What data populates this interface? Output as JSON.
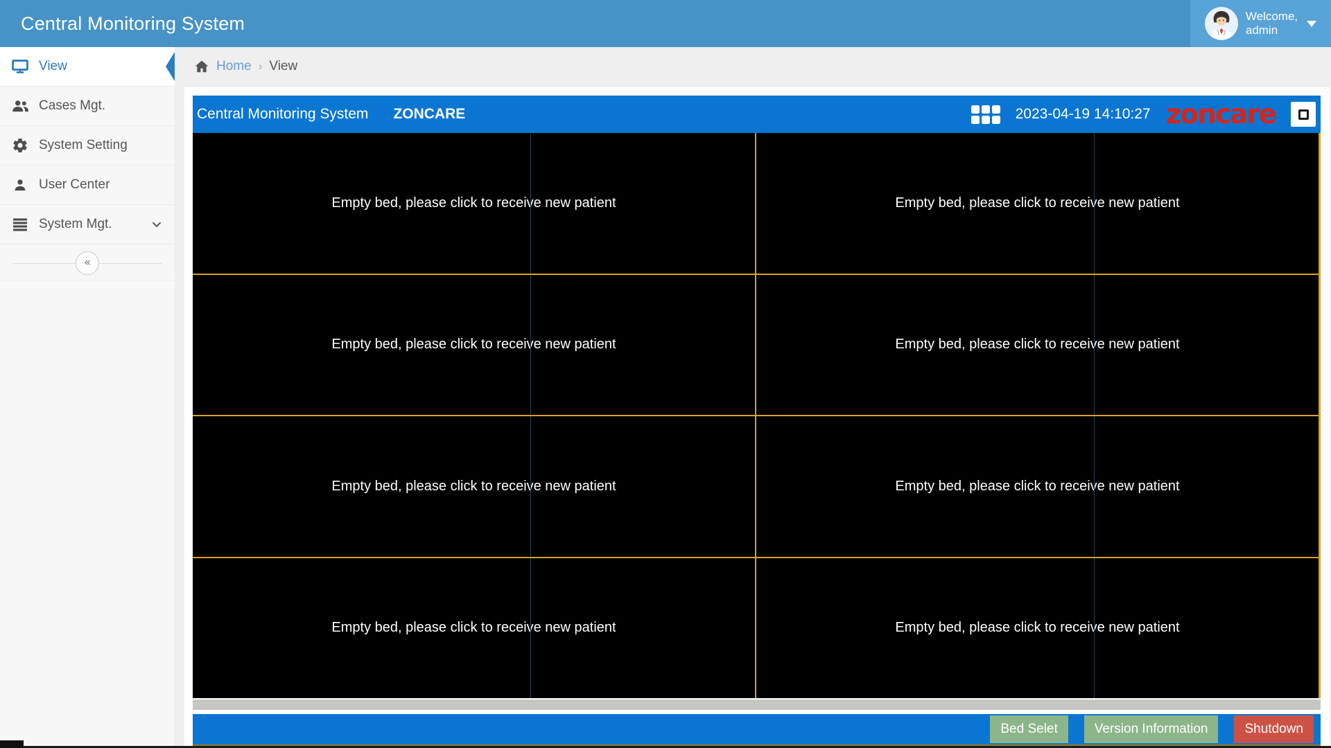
{
  "window_title": "Central Monitoring System",
  "header": {
    "welcome_line1": "Welcome,",
    "welcome_line2": "admin"
  },
  "sidebar": {
    "items": [
      {
        "label": "View",
        "icon": "monitor",
        "active": true
      },
      {
        "label": "Cases Mgt.",
        "icon": "users",
        "active": false
      },
      {
        "label": "System Setting",
        "icon": "gear",
        "active": false
      },
      {
        "label": "User Center",
        "icon": "user",
        "active": false
      },
      {
        "label": "System Mgt.",
        "icon": "menu",
        "active": false,
        "expandable": true
      }
    ],
    "collapse_glyph": "«"
  },
  "breadcrumb": {
    "home": "Home",
    "separator": "›",
    "current": "View"
  },
  "monitor": {
    "titlebar": {
      "title": "Central Monitoring System",
      "brand": "ZONCARE",
      "timestamp": "2023-04-19 14:10:27",
      "logo_text": "zoncare"
    },
    "grid": {
      "rows": 4,
      "cols": 2,
      "empty_bed_text": "Empty bed, please click to receive new patient"
    },
    "footer_buttons": [
      {
        "label": "Bed Selet",
        "style": "green"
      },
      {
        "label": "Version Information",
        "style": "green"
      },
      {
        "label": "Shutdown",
        "style": "red"
      }
    ]
  },
  "colors": {
    "header_blue": "#4792c7",
    "header_user_blue": "#58a3d7",
    "accent_blue": "#2d7cc0",
    "titlebar_blue": "#0a76d2",
    "grid_line_yellow": "#d8a326",
    "cell_divider": "#2f4257",
    "button_green": "#8cb58a",
    "button_red": "#cd5144",
    "logo_red": "#d3251c"
  }
}
